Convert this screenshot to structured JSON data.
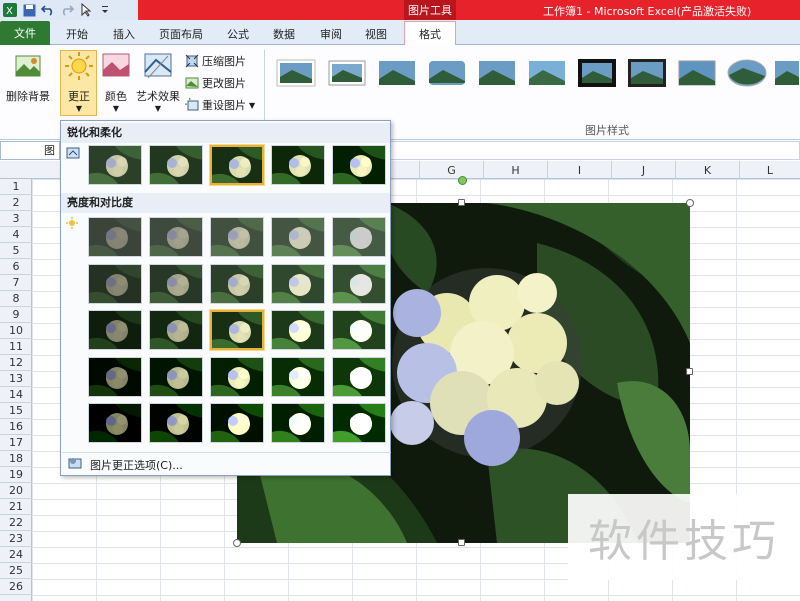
{
  "window": {
    "title": "工作簿1 - Microsoft Excel(产品激活失败)",
    "context_tab_group": "图片工具"
  },
  "qat": {
    "icons": [
      "excel-logo-icon",
      "save-icon",
      "undo-icon",
      "redo-icon",
      "pointer-icon",
      "qat-more-icon"
    ]
  },
  "tabs": [
    "文件",
    "开始",
    "插入",
    "页面布局",
    "公式",
    "数据",
    "审阅",
    "视图",
    "格式"
  ],
  "ribbon": {
    "remove_bg": "删除背景",
    "corrections": "更正",
    "color": "颜色",
    "artistic": "艺术效果",
    "compress": "压缩图片",
    "change": "更改图片",
    "reset": "重设图片",
    "styles_group": "图片样式"
  },
  "namebox": "图",
  "columns": [
    "G",
    "H",
    "I",
    "J",
    "K",
    "L"
  ],
  "rows": [
    "1",
    "2",
    "3",
    "4",
    "5",
    "6",
    "7",
    "8",
    "9",
    "10",
    "11",
    "12",
    "13",
    "14",
    "15",
    "16",
    "17",
    "18",
    "19",
    "20",
    "21",
    "22",
    "23",
    "24",
    "25",
    "26"
  ],
  "dropdown": {
    "section1": "锐化和柔化",
    "section2": "亮度和对比度",
    "options_link": "图片更正选项(C)..."
  },
  "watermark": "软件技巧",
  "colors": {
    "accent_red": "#e8222a",
    "file_green": "#2f7a33",
    "selection": "#e8b13a"
  }
}
